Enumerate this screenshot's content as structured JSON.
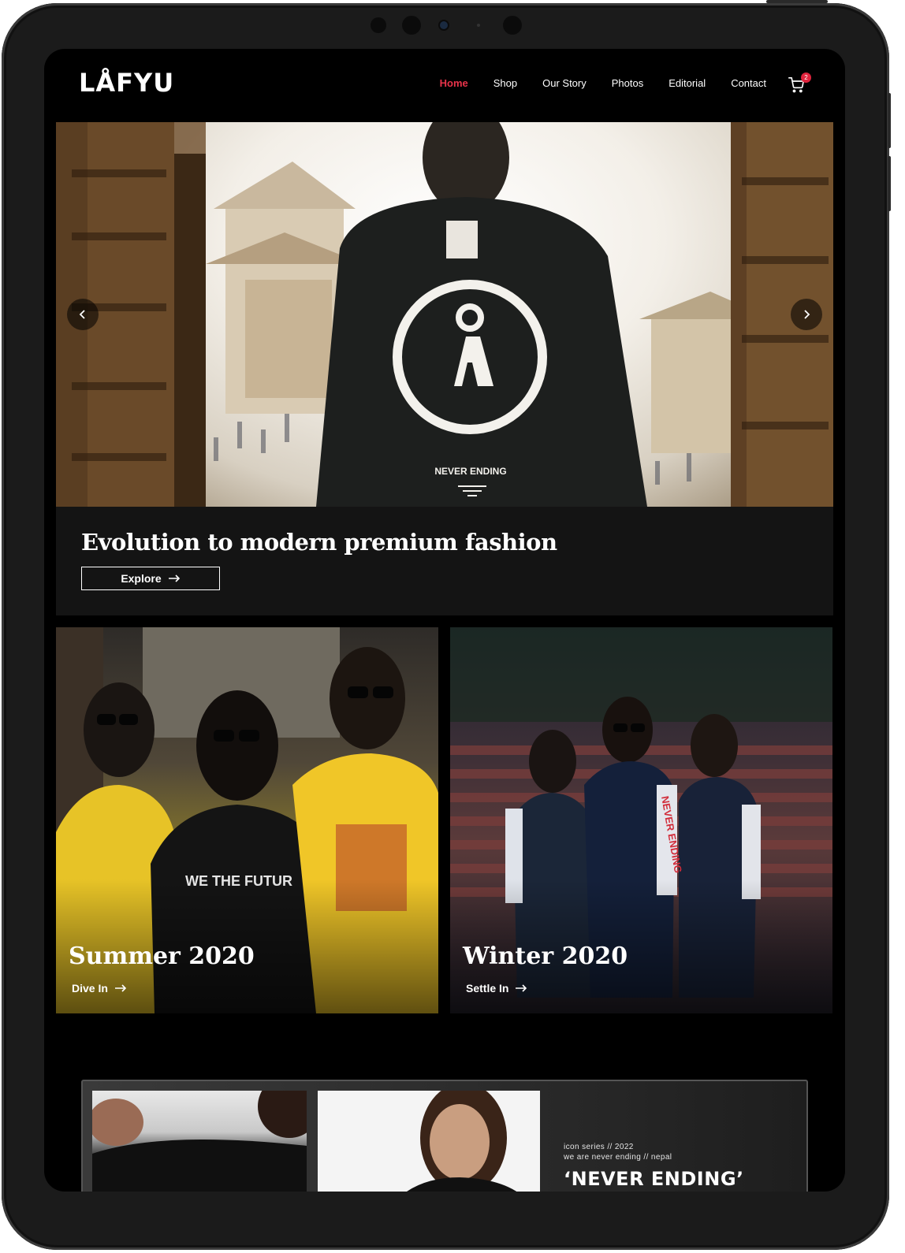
{
  "brand": {
    "logo_text": "LÅFYU"
  },
  "nav": {
    "items": [
      {
        "label": "Home",
        "active": true
      },
      {
        "label": "Shop"
      },
      {
        "label": "Our Story"
      },
      {
        "label": "Photos"
      },
      {
        "label": "Editorial"
      },
      {
        "label": "Contact"
      }
    ],
    "cart_count": "2"
  },
  "hero": {
    "print_text": "NEVER ENDING",
    "title": "Evolution to modern premium fashion",
    "cta_label": "Explore",
    "prev_icon": "chevron-left-icon",
    "next_icon": "chevron-right-icon"
  },
  "collections": [
    {
      "title": "Summer 2020",
      "link_label": "Dive In",
      "shirt_text": "WE THE FUTUR"
    },
    {
      "title": "Winter 2020",
      "link_label": "Settle In",
      "sleeve_text": "NEVER ENDING"
    }
  ],
  "series": {
    "meta_line1": "icon series // 2022",
    "meta_line2": "we are never ending // nepal",
    "title": "‘NEVER ENDING’"
  },
  "colors": {
    "accent": "#e8334a",
    "background": "#000000",
    "panel": "#141414"
  }
}
